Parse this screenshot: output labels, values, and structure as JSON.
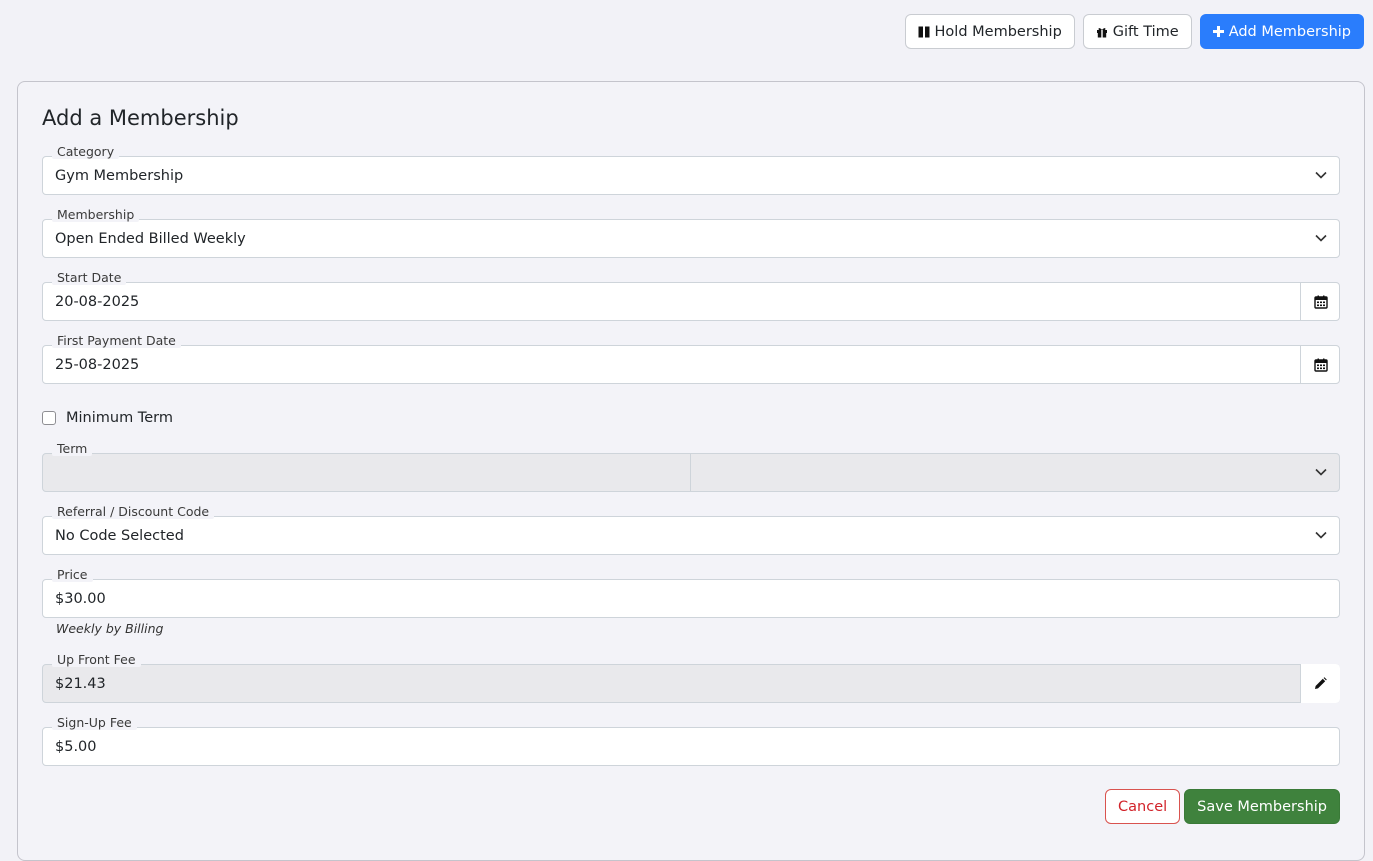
{
  "toolbar": {
    "hold_label": "Hold Membership",
    "gift_label": "Gift Time",
    "add_label": "Add Membership"
  },
  "form": {
    "title": "Add a Membership",
    "category": {
      "label": "Category",
      "value": "Gym Membership"
    },
    "membership": {
      "label": "Membership",
      "value": "Open Ended Billed Weekly"
    },
    "start_date": {
      "label": "Start Date",
      "value": "20-08-2025"
    },
    "first_payment_date": {
      "label": "First Payment Date",
      "value": "25-08-2025"
    },
    "minimum_term": {
      "label": "Minimum Term",
      "checked": false
    },
    "term": {
      "label": "Term",
      "value": "",
      "unit": ""
    },
    "referral": {
      "label": "Referral / Discount Code",
      "value": "No Code Selected"
    },
    "price": {
      "label": "Price",
      "value": "$30.00",
      "help": "Weekly by Billing"
    },
    "up_front_fee": {
      "label": "Up Front Fee",
      "value": "$21.43"
    },
    "sign_up_fee": {
      "label": "Sign-Up Fee",
      "value": "$5.00"
    }
  },
  "actions": {
    "cancel_label": "Cancel",
    "save_label": "Save Membership"
  },
  "colors": {
    "primary": "#2a7dfc",
    "success": "#3f823d",
    "danger": "#d2232a",
    "background": "#f2f2f7"
  },
  "icons": {
    "hold": "pause-icon",
    "gift": "gift-icon",
    "add": "plus-icon",
    "calendar": "calendar-icon",
    "edit": "pencil-icon",
    "dropdown": "chevron-down-icon"
  }
}
